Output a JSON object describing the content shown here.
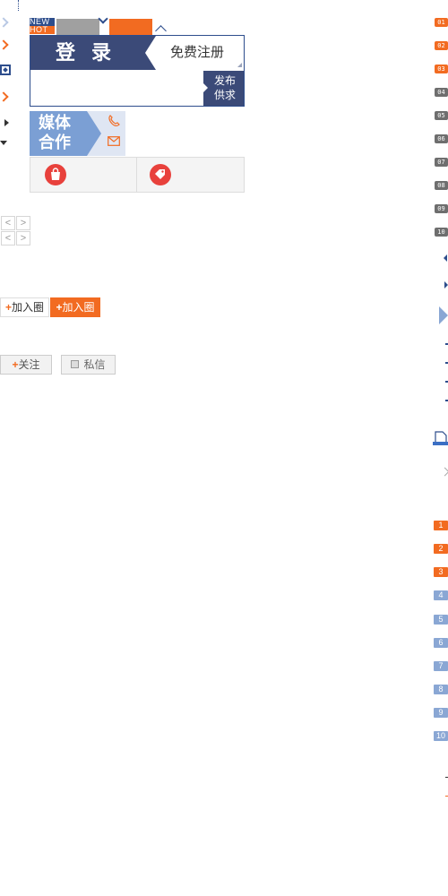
{
  "tags": {
    "new": "NEW",
    "hot": "HOT"
  },
  "login": {
    "login_label": "登 录",
    "register_label": "免费注册",
    "publish_line1": "发布",
    "publish_line2": "供求"
  },
  "media": {
    "line1": "媒体",
    "line2": "合作"
  },
  "pager": {
    "prev": "<",
    "next": ">"
  },
  "join": {
    "plus": "+",
    "label_white": "加入圈",
    "label_orange": "加入圈"
  },
  "social": {
    "follow_plus": "+",
    "follow_label": "关注",
    "message_label": "私信"
  },
  "rank_top": [
    "01",
    "02",
    "03",
    "04",
    "05",
    "06",
    "07",
    "08",
    "09",
    "10"
  ],
  "rank_list": [
    "1",
    "2",
    "3",
    "4",
    "5",
    "6",
    "7",
    "8",
    "9",
    "10"
  ],
  "colors": {
    "brand_blue": "#2d4d8c",
    "accent_orange": "#f26b21",
    "rank_grey": "#6e6e6e",
    "rank_blue": "#8aa7d4"
  }
}
